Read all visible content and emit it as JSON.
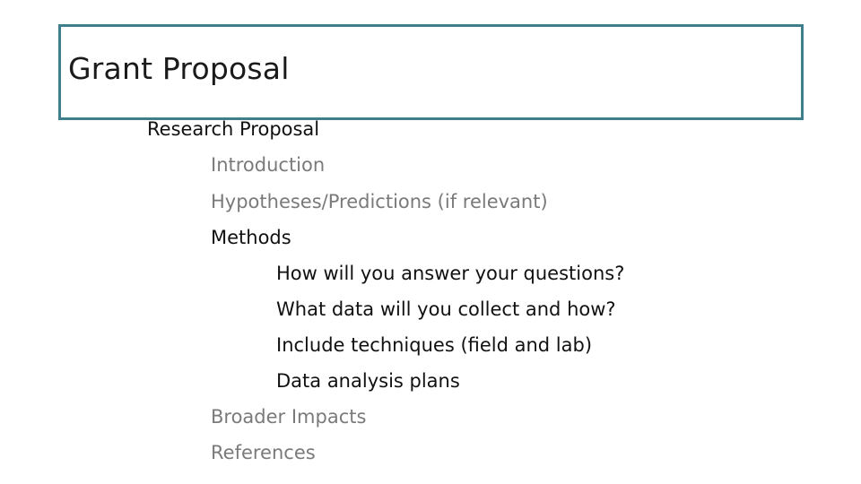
{
  "slide": {
    "title": "Grant Proposal",
    "accent_color": "#3f7f8c",
    "outline": [
      {
        "text": "Research Proposal",
        "level": 1,
        "emphasis": "dark"
      },
      {
        "text": "Introduction",
        "level": 2,
        "emphasis": "gray"
      },
      {
        "text": "Hypotheses/Predictions (if relevant)",
        "level": 2,
        "emphasis": "gray"
      },
      {
        "text": "Methods",
        "level": 2,
        "emphasis": "dark"
      },
      {
        "text": "How will you answer your questions?",
        "level": 3,
        "emphasis": "dark"
      },
      {
        "text": "What data will you collect and how?",
        "level": 3,
        "emphasis": "dark"
      },
      {
        "text": "Include techniques (field and lab)",
        "level": 3,
        "emphasis": "dark"
      },
      {
        "text": "Data analysis plans",
        "level": 3,
        "emphasis": "dark"
      },
      {
        "text": "Broader Impacts",
        "level": 2,
        "emphasis": "gray"
      },
      {
        "text": "References",
        "level": 2,
        "emphasis": "gray"
      }
    ]
  }
}
